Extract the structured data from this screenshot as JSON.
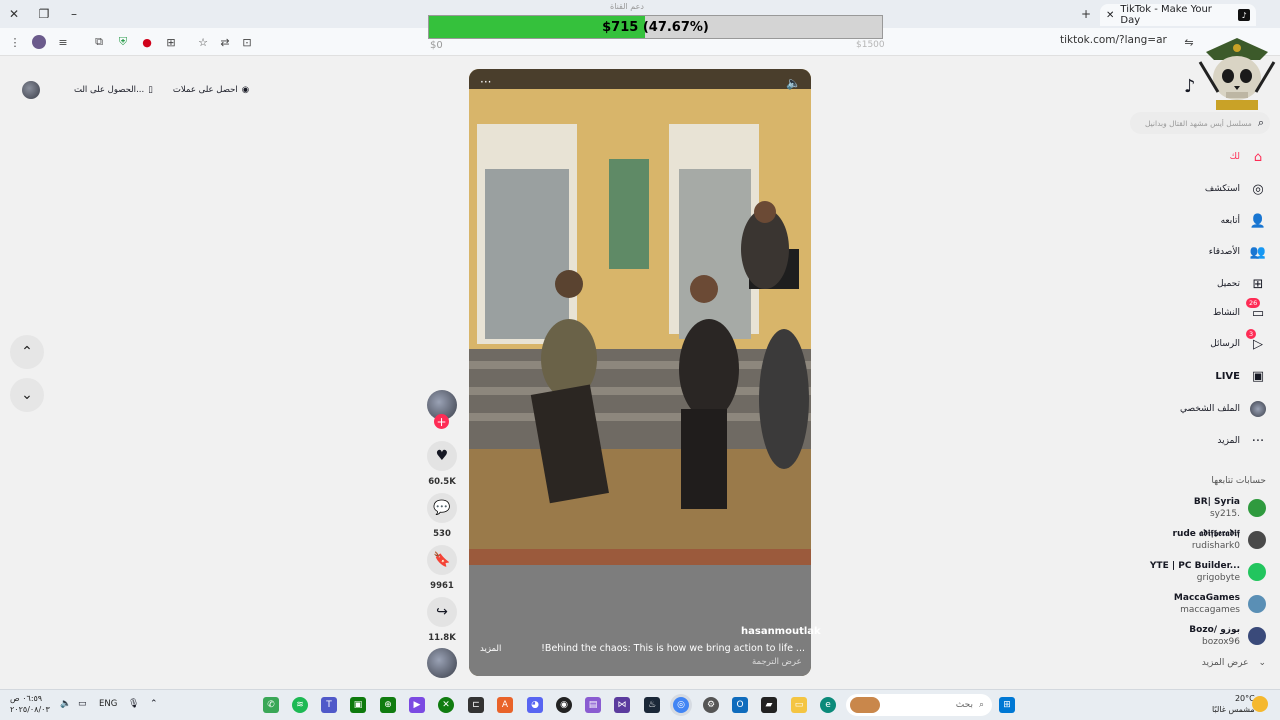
{
  "browser": {
    "tab_title": "TikTok - Make Your Day",
    "url": "tiktok.com/?lang=ar"
  },
  "donation": {
    "top_label": "دعم القناة",
    "text": "$715 (47.67%)",
    "progress": 0.4767,
    "min_label": "$0",
    "max_label": "$1500"
  },
  "left": {
    "get_coins": "احصل على عملات",
    "get_app": "الحصول على الت...",
    "up_icon": "chevron-up-icon",
    "down_icon": "chevron-down-icon"
  },
  "video": {
    "author": "hasanmoutlak",
    "caption": "!Behind the chaos: This is how we bring action to life ...",
    "more": "المزيد",
    "translate": "عرض الترجمة"
  },
  "actions": {
    "likes": "60.5K",
    "comments": "530",
    "saves": "9961",
    "shares": "11.8K"
  },
  "nav": {
    "search_placeholder": "مسلسل أيس مشهد القتال وبدانيل على ...",
    "items": [
      {
        "label": "لك",
        "icon": "home-icon"
      },
      {
        "label": "استكشف",
        "icon": "compass-icon"
      },
      {
        "label": "أتابعه",
        "icon": "following-icon"
      },
      {
        "label": "الأصدقاء",
        "icon": "friends-icon"
      },
      {
        "label": "تحميل",
        "icon": "upload-icon"
      },
      {
        "label": "النشاط",
        "icon": "activity-icon",
        "badge": "26"
      },
      {
        "label": "الرسائل",
        "icon": "messages-icon",
        "badge": "3"
      },
      {
        "label": "LIVE",
        "icon": "live-icon"
      },
      {
        "label": "الملف الشخصي",
        "icon": "profile-icon"
      },
      {
        "label": "المزيد",
        "icon": "more-icon"
      }
    ],
    "following_title": "حسابات تتابعها",
    "following": [
      {
        "name": "BR| Syria",
        "handle": "sy215."
      },
      {
        "name": "rude 𝖆𝖉𝖎𝖋𝖇𝖊𝖗𝖆𝖉𝖎𝖋",
        "handle": "rudishark0"
      },
      {
        "name": "YTE | PC Builder...",
        "handle": "grigobyte"
      },
      {
        "name": "MaccaGames",
        "handle": "maccagames"
      },
      {
        "name": "Bozo/ بوزو",
        "handle": "bozox96"
      }
    ],
    "see_more": "عرض المزيد"
  },
  "taskbar": {
    "time": "٠٦:٥٩ ص",
    "date": "٢٠٢٥/٠٨/٠٣",
    "lang": "ENG",
    "search_label": "بحث",
    "temp": "20°C",
    "weather": "مشمس غالبًا"
  },
  "colors": {
    "accent": "#fe2c55",
    "progress": "#35c13c"
  }
}
